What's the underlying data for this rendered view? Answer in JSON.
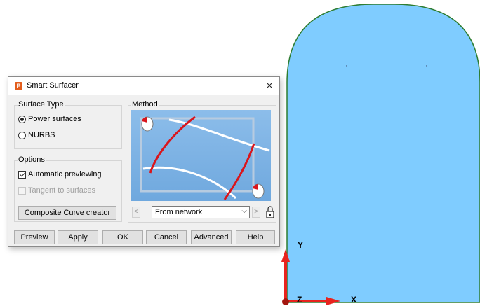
{
  "dialog": {
    "title": "Smart Surfacer",
    "app_icon_letter": "P",
    "close_glyph": "×",
    "surface_type": {
      "label": "Surface Type",
      "options": [
        {
          "label": "Power surfaces",
          "selected": true
        },
        {
          "label": "NURBS",
          "selected": false
        }
      ]
    },
    "options": {
      "label": "Options",
      "automatic_previewing": {
        "label": "Automatic previewing",
        "checked": true
      },
      "tangent_to_surfaces": {
        "label": "Tangent to surfaces",
        "checked": false,
        "disabled": true
      }
    },
    "composite_curve_button": "Composite Curve creator",
    "method": {
      "label": "Method",
      "selected": "From network",
      "prev_glyph": "<",
      "next_glyph": ">",
      "dropdown_glyph": "⌵"
    },
    "buttons": {
      "preview": "Preview",
      "apply": "Apply",
      "ok": "OK",
      "cancel": "Cancel",
      "advanced": "Advanced",
      "help": "Help"
    }
  },
  "viewport": {
    "surface_color": "#7fccff",
    "surface_border": "#2e7d32",
    "axis_color": "#e8231e",
    "axes": {
      "y": "Y",
      "x": "X",
      "z": "Z"
    }
  }
}
